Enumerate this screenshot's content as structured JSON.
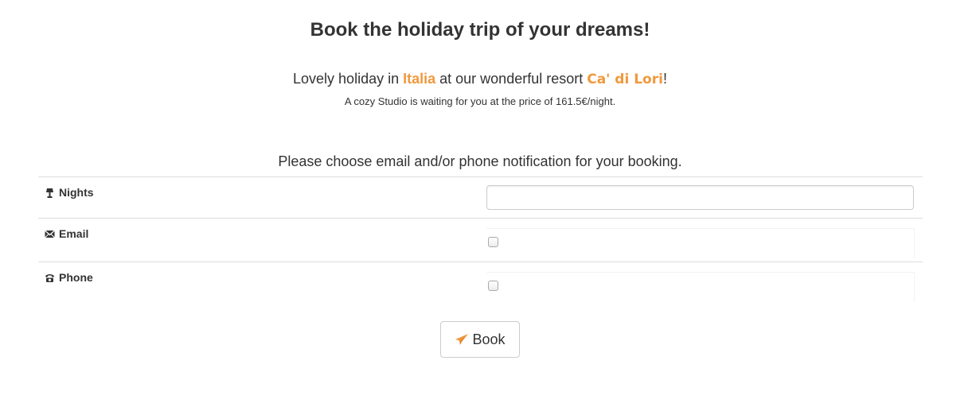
{
  "header": {
    "title": "Book the holiday trip of your dreams!"
  },
  "intro": {
    "prefix": "Lovely holiday in ",
    "country": "Italia",
    "middle": " at our wonderful resort ",
    "resort": "Ca' di Lori",
    "suffix": "!",
    "offer": "A cozy Studio is waiting for you at the price of 161.5€/night."
  },
  "form": {
    "instruction": "Please choose email and/or phone notification for your booking.",
    "fields": [
      {
        "label": "Nights",
        "icon": "lamp-icon",
        "type": "text",
        "value": ""
      },
      {
        "label": "Email",
        "icon": "envelope-icon",
        "type": "checkbox",
        "checked": false
      },
      {
        "label": "Phone",
        "icon": "phone-icon",
        "type": "checkbox",
        "checked": false
      }
    ],
    "book_label": "Book",
    "book_icon": "paper-plane-icon"
  },
  "colors": {
    "accent": "#f0993d",
    "text": "#333333",
    "border": "#dddddd"
  }
}
